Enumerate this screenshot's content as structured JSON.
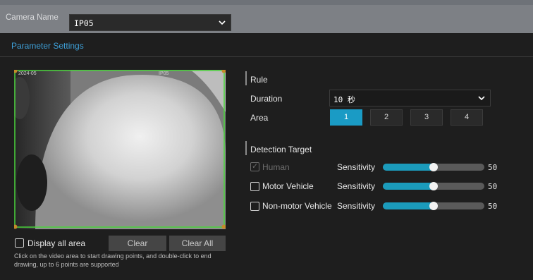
{
  "camera": {
    "label": "Camera Name",
    "selected": "IP05"
  },
  "tabs": [
    {
      "label": "Parameter Settings",
      "active": true
    }
  ],
  "video": {
    "osd_left": "2024-05",
    "osd_right": "IP05"
  },
  "display_all_area": {
    "label": "Display all area",
    "checked": false
  },
  "buttons": {
    "clear": "Clear",
    "clear_all": "Clear All"
  },
  "help_text": "Click on the video area to start drawing points, and double-click to end drawing, up to 6 points are supported",
  "rule": {
    "title": "Rule",
    "duration_label": "Duration",
    "duration_value": "10 秒",
    "area_label": "Area",
    "areas": [
      {
        "label": "1",
        "active": true
      },
      {
        "label": "2",
        "active": false
      },
      {
        "label": "3",
        "active": false
      },
      {
        "label": "4",
        "active": false
      }
    ]
  },
  "detection": {
    "title": "Detection Target",
    "sensitivity_label": "Sensitivity",
    "targets": [
      {
        "name": "Human",
        "checked": true,
        "disabled": true,
        "sensitivity": "50",
        "level": 0.5
      },
      {
        "name": "Motor Vehicle",
        "checked": false,
        "disabled": false,
        "sensitivity": "50",
        "level": 0.5
      },
      {
        "name": "Non-motor Vehicle",
        "checked": false,
        "disabled": false,
        "sensitivity": "50",
        "level": 0.5
      }
    ]
  },
  "colors": {
    "accent": "#1a9bc5",
    "region": "#49d33a",
    "tab": "#3ea0d8"
  }
}
